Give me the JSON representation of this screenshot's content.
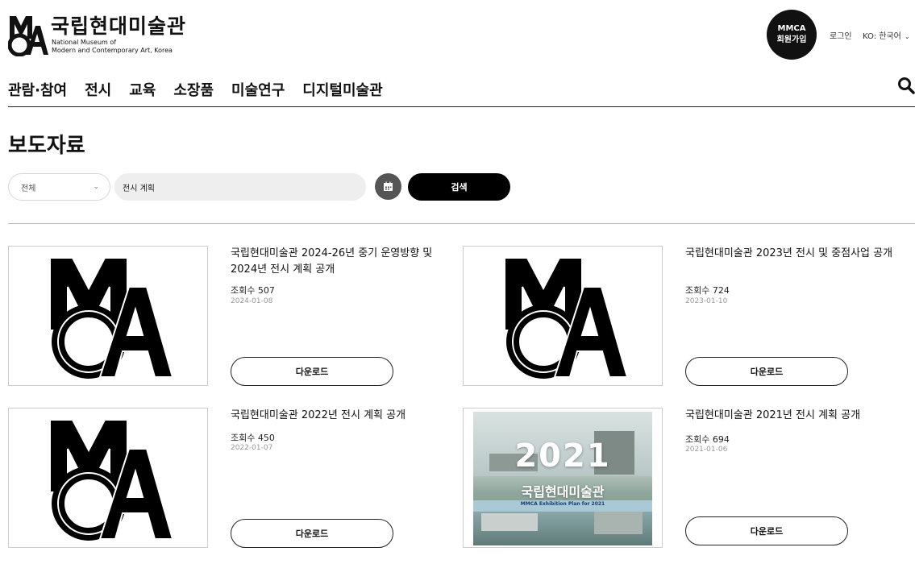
{
  "header": {
    "brand_ko": "국립현대미술관",
    "brand_en_line1": "National Museum of",
    "brand_en_line2": "Modern and Contemporary Art, Korea",
    "member_line1": "MMCA",
    "member_line2": "회원가입",
    "login": "로그인",
    "language": "KO: 한국어"
  },
  "nav": {
    "items": [
      "관람·참여",
      "전시",
      "교육",
      "소장품",
      "미술연구",
      "디지털미술관"
    ]
  },
  "page": {
    "title": "보도자료"
  },
  "search": {
    "category": "전체",
    "query": "전시 계획",
    "button": "검색"
  },
  "cards": [
    {
      "title": "국립현대미술관 2024-26년 중기 운영방향 및 2024년 전시 계획 공개",
      "views": "조회수 507",
      "date": "2024-01-08",
      "download": "다운로드"
    },
    {
      "title": "국립현대미술관 2023년 전시 및 중점사업 공개",
      "views": "조회수 724",
      "date": "2023-01-10",
      "download": "다운로드"
    },
    {
      "title": "국립현대미술관 2022년 전시 계획 공개",
      "views": "조회수 450",
      "date": "2022-01-07",
      "download": "다운로드"
    },
    {
      "title": "국립현대미술관 2021년 전시 계획 공개",
      "views": "조회수 694",
      "date": "2021-01-06",
      "download": "다운로드"
    }
  ],
  "poster": {
    "year": "2021",
    "name": "국립현대미술관",
    "subtitle": "MMCA Exhibition Plan for 2021"
  },
  "colors": {
    "primary": "#000000",
    "search_bg": "#eeeeee",
    "calendar_btn": "#555555"
  }
}
